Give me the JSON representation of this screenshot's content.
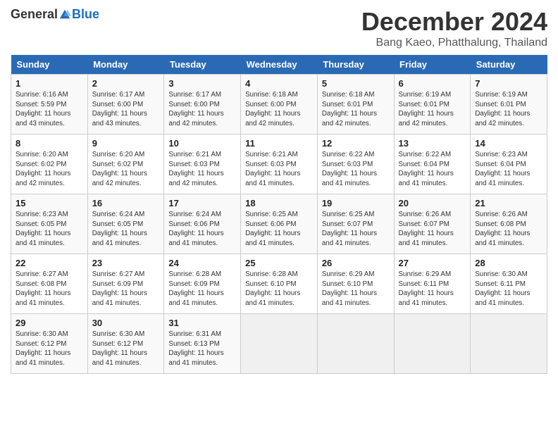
{
  "header": {
    "logo_general": "General",
    "logo_blue": "Blue",
    "month_title": "December 2024",
    "location": "Bang Kaeo, Phatthalung, Thailand"
  },
  "weekdays": [
    "Sunday",
    "Monday",
    "Tuesday",
    "Wednesday",
    "Thursday",
    "Friday",
    "Saturday"
  ],
  "weeks": [
    [
      {
        "day": "1",
        "rise": "6:16 AM",
        "set": "5:59 PM",
        "daylight": "11 hours and 43 minutes."
      },
      {
        "day": "2",
        "rise": "6:17 AM",
        "set": "6:00 PM",
        "daylight": "11 hours and 43 minutes."
      },
      {
        "day": "3",
        "rise": "6:17 AM",
        "set": "6:00 PM",
        "daylight": "11 hours and 42 minutes."
      },
      {
        "day": "4",
        "rise": "6:18 AM",
        "set": "6:00 PM",
        "daylight": "11 hours and 42 minutes."
      },
      {
        "day": "5",
        "rise": "6:18 AM",
        "set": "6:01 PM",
        "daylight": "11 hours and 42 minutes."
      },
      {
        "day": "6",
        "rise": "6:19 AM",
        "set": "6:01 PM",
        "daylight": "11 hours and 42 minutes."
      },
      {
        "day": "7",
        "rise": "6:19 AM",
        "set": "6:01 PM",
        "daylight": "11 hours and 42 minutes."
      }
    ],
    [
      {
        "day": "8",
        "rise": "6:20 AM",
        "set": "6:02 PM",
        "daylight": "11 hours and 42 minutes."
      },
      {
        "day": "9",
        "rise": "6:20 AM",
        "set": "6:02 PM",
        "daylight": "11 hours and 42 minutes."
      },
      {
        "day": "10",
        "rise": "6:21 AM",
        "set": "6:03 PM",
        "daylight": "11 hours and 42 minutes."
      },
      {
        "day": "11",
        "rise": "6:21 AM",
        "set": "6:03 PM",
        "daylight": "11 hours and 41 minutes."
      },
      {
        "day": "12",
        "rise": "6:22 AM",
        "set": "6:03 PM",
        "daylight": "11 hours and 41 minutes."
      },
      {
        "day": "13",
        "rise": "6:22 AM",
        "set": "6:04 PM",
        "daylight": "11 hours and 41 minutes."
      },
      {
        "day": "14",
        "rise": "6:23 AM",
        "set": "6:04 PM",
        "daylight": "11 hours and 41 minutes."
      }
    ],
    [
      {
        "day": "15",
        "rise": "6:23 AM",
        "set": "6:05 PM",
        "daylight": "11 hours and 41 minutes."
      },
      {
        "day": "16",
        "rise": "6:24 AM",
        "set": "6:05 PM",
        "daylight": "11 hours and 41 minutes."
      },
      {
        "day": "17",
        "rise": "6:24 AM",
        "set": "6:06 PM",
        "daylight": "11 hours and 41 minutes."
      },
      {
        "day": "18",
        "rise": "6:25 AM",
        "set": "6:06 PM",
        "daylight": "11 hours and 41 minutes."
      },
      {
        "day": "19",
        "rise": "6:25 AM",
        "set": "6:07 PM",
        "daylight": "11 hours and 41 minutes."
      },
      {
        "day": "20",
        "rise": "6:26 AM",
        "set": "6:07 PM",
        "daylight": "11 hours and 41 minutes."
      },
      {
        "day": "21",
        "rise": "6:26 AM",
        "set": "6:08 PM",
        "daylight": "11 hours and 41 minutes."
      }
    ],
    [
      {
        "day": "22",
        "rise": "6:27 AM",
        "set": "6:08 PM",
        "daylight": "11 hours and 41 minutes."
      },
      {
        "day": "23",
        "rise": "6:27 AM",
        "set": "6:09 PM",
        "daylight": "11 hours and 41 minutes."
      },
      {
        "day": "24",
        "rise": "6:28 AM",
        "set": "6:09 PM",
        "daylight": "11 hours and 41 minutes."
      },
      {
        "day": "25",
        "rise": "6:28 AM",
        "set": "6:10 PM",
        "daylight": "11 hours and 41 minutes."
      },
      {
        "day": "26",
        "rise": "6:29 AM",
        "set": "6:10 PM",
        "daylight": "11 hours and 41 minutes."
      },
      {
        "day": "27",
        "rise": "6:29 AM",
        "set": "6:11 PM",
        "daylight": "11 hours and 41 minutes."
      },
      {
        "day": "28",
        "rise": "6:30 AM",
        "set": "6:11 PM",
        "daylight": "11 hours and 41 minutes."
      }
    ],
    [
      {
        "day": "29",
        "rise": "6:30 AM",
        "set": "6:12 PM",
        "daylight": "11 hours and 41 minutes."
      },
      {
        "day": "30",
        "rise": "6:30 AM",
        "set": "6:12 PM",
        "daylight": "11 hours and 41 minutes."
      },
      {
        "day": "31",
        "rise": "6:31 AM",
        "set": "6:13 PM",
        "daylight": "11 hours and 41 minutes."
      },
      null,
      null,
      null,
      null
    ]
  ]
}
